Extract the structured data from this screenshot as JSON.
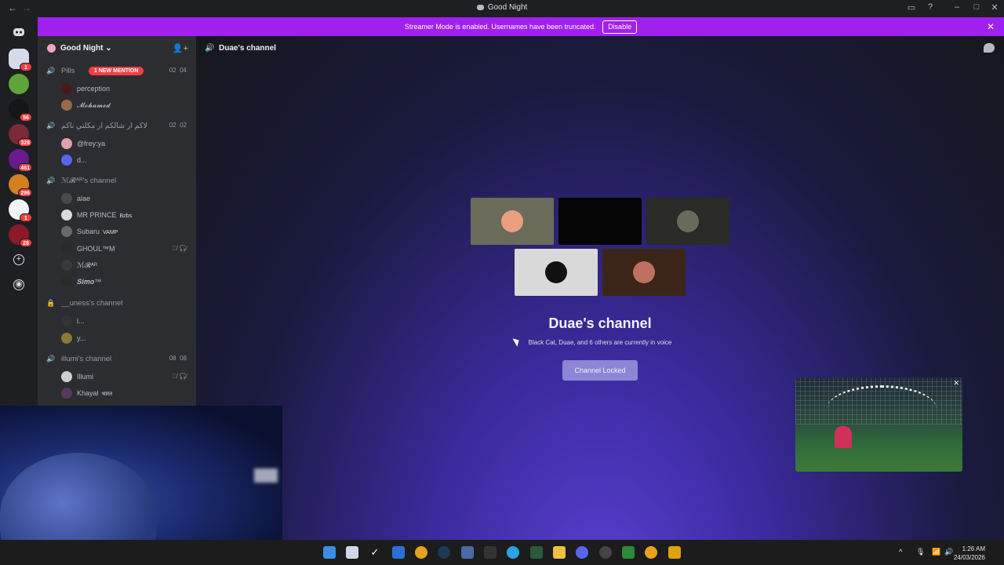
{
  "titlebar": {
    "title": "Good Night"
  },
  "banner": {
    "text": "Streamer Mode is enabled. Usernames have been truncated.",
    "disable_label": "Disable"
  },
  "rail": {
    "badges": [
      "1",
      "56",
      "328",
      "461",
      "296",
      "1",
      "28"
    ]
  },
  "sidebar": {
    "server_name": "Good Night",
    "channels": [
      {
        "name": "Pills",
        "mention": "1 NEW MENTION",
        "count_a": "02",
        "count_b": "04",
        "users": [
          {
            "name": "perception",
            "tag": ""
          },
          {
            "name": "𝓜𝓸𝓱𝓪𝓶𝓮𝓭",
            "tag": ""
          }
        ]
      },
      {
        "name": "لاكم ار شالكم ار مكلتي ناكم",
        "count_a": "02",
        "count_b": "02",
        "users": [
          {
            "name": "@frey:ya",
            "tag": ""
          },
          {
            "name": "d...",
            "tag": ""
          }
        ]
      },
      {
        "name": "ℳ𝓡ᴬᴿ's channel",
        "users": [
          {
            "name": "alae",
            "tag": ""
          },
          {
            "name": "MR PRINCE",
            "tag": "Bzbs"
          },
          {
            "name": "Subaru",
            "tag": "VAMP"
          },
          {
            "name": "GHOUL™M",
            "tag": ""
          },
          {
            "name": "ℳ𝓡ᴬᴿ",
            "tag": ""
          },
          {
            "name": "𝑺𝒊𝒎𝒐™",
            "tag": ""
          }
        ]
      },
      {
        "name": "__uness's channel",
        "users": [
          {
            "name": "l...",
            "tag": ""
          },
          {
            "name": "y...",
            "tag": ""
          }
        ]
      },
      {
        "name": "illumi's channel",
        "count_a": "08",
        "count_b": "08",
        "users": [
          {
            "name": "Illumi",
            "tag": ""
          },
          {
            "name": "Khayal",
            "tag": "भारत"
          }
        ]
      }
    ]
  },
  "main": {
    "channel_name": "Duae's channel",
    "voice_title": "Duae's channel",
    "voice_subtitle": "Black Cat, Duae, and 6 others are currently in voice",
    "lock_button": "Channel Locked"
  },
  "taskbar": {
    "time": "1:26 AM",
    "date": "24/03/2026"
  },
  "colors": {
    "accent": "#a020f0",
    "mention": "#f23f43",
    "sidebar": "#2b2d31",
    "rail": "#1e1f22"
  }
}
